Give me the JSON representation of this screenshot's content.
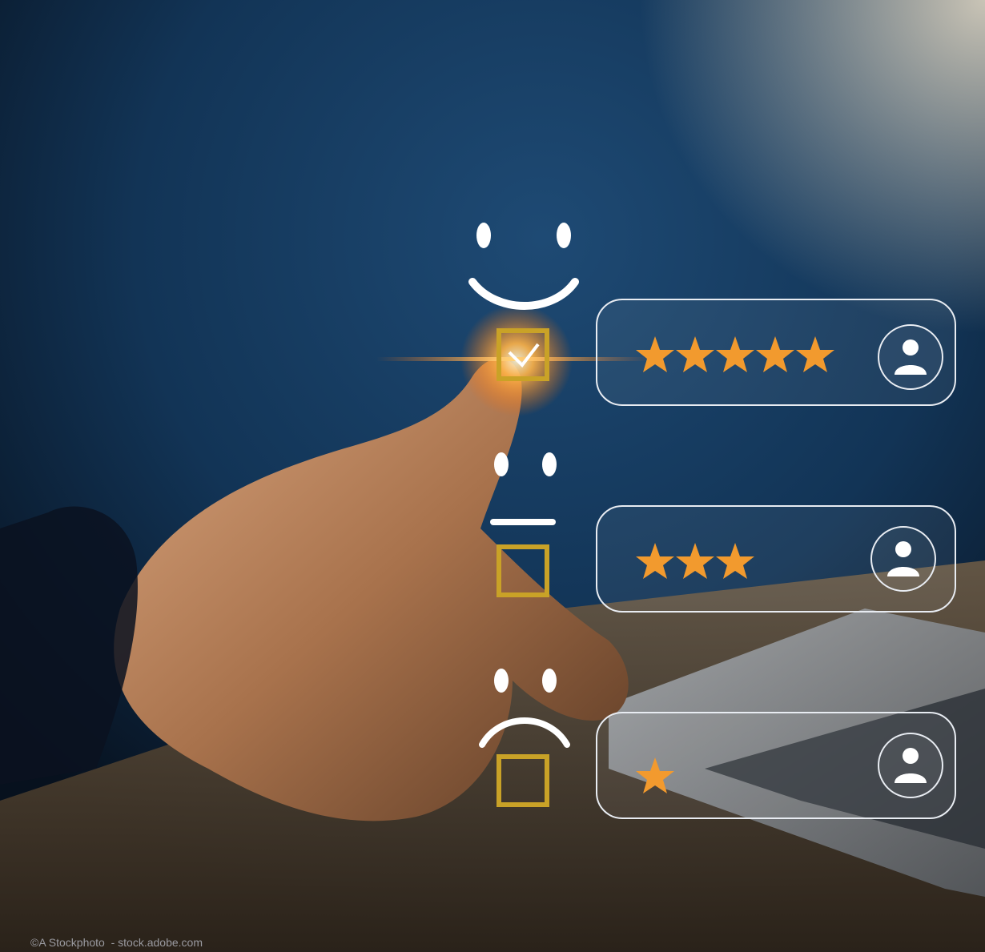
{
  "credit": "©A Stockphoto  - stock.adobe.com",
  "rating_rows": [
    {
      "mood": "happy",
      "stars": 5,
      "checked": true,
      "icon": "user-icon"
    },
    {
      "mood": "neutral",
      "stars": 3,
      "checked": false,
      "icon": "user-icon"
    },
    {
      "mood": "sad",
      "stars": 1,
      "checked": false,
      "icon": "user-icon"
    }
  ],
  "colors": {
    "star": "#f29a2e",
    "checkbox": "#c9a227",
    "panel_border": "#e8ecf2",
    "face": "#ffffff",
    "glow": "#ff8a2a"
  }
}
